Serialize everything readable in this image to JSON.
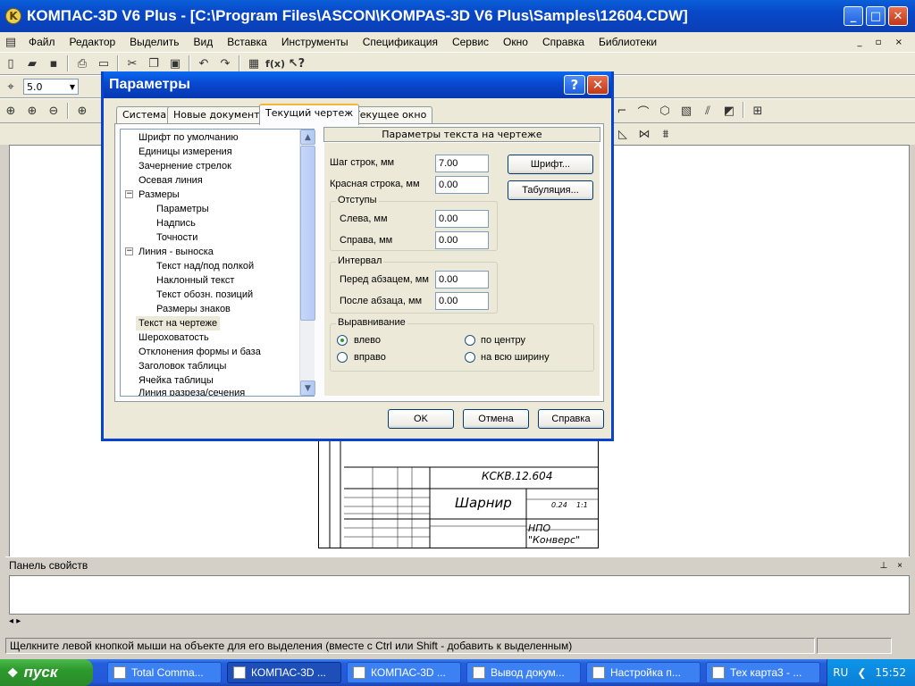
{
  "window": {
    "title": "КОМПАС-3D V6 Plus - [C:\\Program Files\\ASCON\\KOMPAS-3D V6 Plus\\Samples\\12604.CDW]",
    "minimize": "_",
    "maximize": "□",
    "close": "✕"
  },
  "menu": [
    "Файл",
    "Редактор",
    "Выделить",
    "Вид",
    "Вставка",
    "Инструменты",
    "Спецификация",
    "Сервис",
    "Окно",
    "Справка",
    "Библиотеки"
  ],
  "toolbar": {
    "step_value": "5.0"
  },
  "dialog": {
    "title": "Параметры",
    "help": "?",
    "close": "✕",
    "tabs": [
      "Система",
      "Новые документы",
      "Текущий чертеж",
      "Текущее окно"
    ],
    "tree": [
      "Шрифт по умолчанию",
      "Единицы измерения",
      "Зачернение стрелок",
      "Осевая линия",
      "Размеры",
      "Параметры",
      "Надпись",
      "Точности",
      "Линия - выноска",
      "Текст над/под полкой",
      "Наклонный текст",
      "Текст обозн. позиций",
      "Размеры знаков",
      "Текст на чертеже",
      "Шероховатость",
      "Отклонения формы и база",
      "Заголовок таблицы",
      "Ячейка таблицы",
      "Линия разреза/сечения"
    ],
    "panel": {
      "title": "Параметры текста на чертеже",
      "line_step_label": "Шаг строк, мм",
      "line_step_value": "7.00",
      "red_line_label": "Красная строка, мм",
      "red_line_value": "0.00",
      "indents_group": "Отступы",
      "left_label": "Слева, мм",
      "left_value": "0.00",
      "right_label": "Справа, мм",
      "right_value": "0.00",
      "interval_group": "Интервал",
      "before_label": "Перед абзацем, мм",
      "before_value": "0.00",
      "after_label": "После абзаца, мм",
      "after_value": "0.00",
      "font_button": "Шрифт...",
      "tab_button": "Табуляция...",
      "align_group": "Выравнивание",
      "align_left": "влево",
      "align_center": "по центру",
      "align_right": "вправо",
      "align_justify": "на всю ширину"
    },
    "ok": "OK",
    "cancel": "Отмена",
    "help_button": "Справка"
  },
  "drawing": {
    "code": "КСКВ.12.604",
    "name": "Шарнир",
    "org": "НПО \"Конверс\"",
    "mass": "0.24",
    "scale": "1:1"
  },
  "properties_panel": {
    "title": "Панель свойств"
  },
  "status": {
    "text": "Щелкните левой кнопкой мыши на объекте для его выделения (вместе с Ctrl или Shift - добавить к выделенным)"
  },
  "taskbar": {
    "start": "пуск",
    "tasks": [
      "Total Comma...",
      "КОМПАС-3D ...",
      "КОМПАС-3D ...",
      "Вывод докум...",
      "Настройка п...",
      "Тех карта3 - ..."
    ],
    "lang": "RU",
    "clock": "15:52"
  }
}
